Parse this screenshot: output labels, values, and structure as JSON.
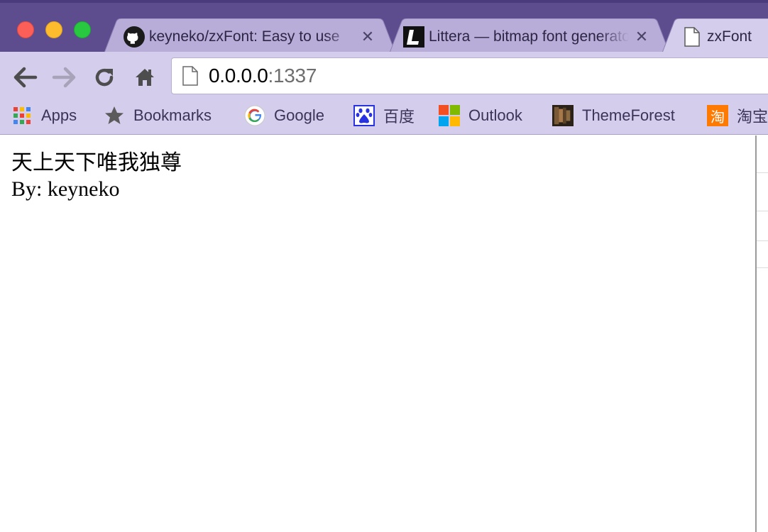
{
  "window": {
    "traffic_lights": [
      "close",
      "minimize",
      "zoom"
    ]
  },
  "tabs": [
    {
      "title": "keyneko/zxFont: Easy to use",
      "favicon": "github-icon",
      "active": false
    },
    {
      "title": "Littera — bitmap font generator",
      "favicon": "littera-icon",
      "active": false
    },
    {
      "title": "zxFont",
      "favicon": "page-icon",
      "active": true
    }
  ],
  "toolbar": {
    "url_host": "0.0.0.0",
    "url_port": ":1337",
    "back_icon": "arrow-left-icon",
    "forward_icon": "arrow-right-icon",
    "reload_icon": "reload-icon",
    "home_icon": "home-icon"
  },
  "bookmarks": [
    {
      "label": "Apps",
      "icon": "apps-grid-icon"
    },
    {
      "label": "Bookmarks",
      "icon": "star-icon"
    },
    {
      "label": "Google",
      "icon": "google-icon"
    },
    {
      "label": "百度",
      "icon": "baidu-paw-icon"
    },
    {
      "label": "Outlook",
      "icon": "windows-icon"
    },
    {
      "label": "ThemeForest",
      "icon": "themeforest-icon"
    },
    {
      "label": "淘宝",
      "icon": "taobao-icon",
      "icon_text": "淘"
    }
  ],
  "page": {
    "heading": "天上天下唯我独尊",
    "byline": "By: keyneko"
  },
  "colors": {
    "tabstrip": "#5d4d8e",
    "toolbar": "#d5cdec",
    "active_tab": "#d5cdec",
    "inactive_tab": "#b8add8"
  }
}
